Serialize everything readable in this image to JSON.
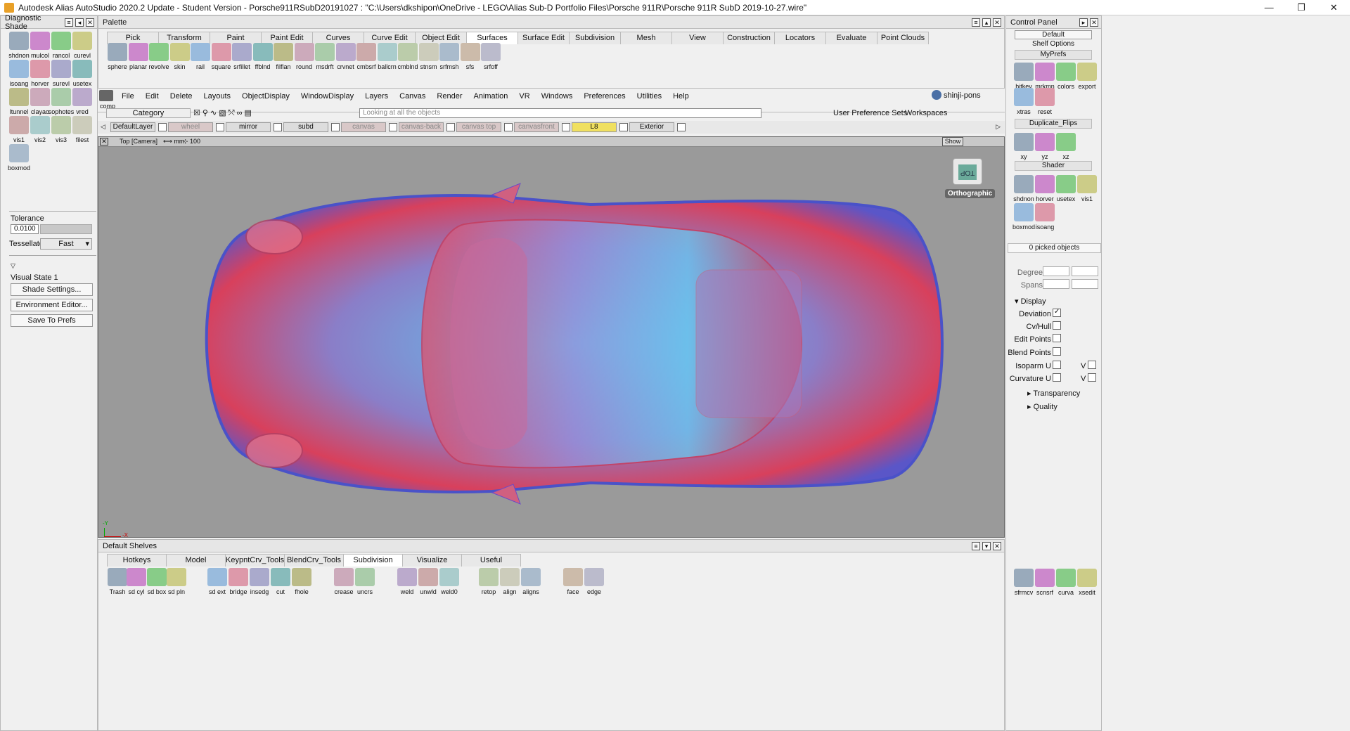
{
  "window": {
    "title": "Autodesk Alias AutoStudio 2020.2 Update - Student Version  - Porsche911RSubD20191027 : \"C:\\Users\\dkshipon\\OneDrive - LEGO\\Alias Sub-D Portfolio Files\\Porsche 911R\\Porsche 911R SubD 2019-10-27.wire\"",
    "minimize": "—",
    "restore": "❐",
    "close": "✕"
  },
  "left_panel": {
    "title": "Diagnostic Shade",
    "tools": [
      "shdnon",
      "mulcol",
      "rancol",
      "curevl",
      "isoang",
      "horver",
      "surevl",
      "usetex",
      "ltunnel",
      "clayao",
      "sophotes",
      "vred",
      "vis1",
      "vis2",
      "vis3",
      "filest",
      "boxmod"
    ],
    "tolerance_label": "Tolerance",
    "tolerance_value": "0.0100",
    "tessellator_label": "Tessellator",
    "tessellator_value": "Fast",
    "visual_state": "Visual State 1",
    "shade_settings": "Shade Settings...",
    "environment_editor": "Environment Editor...",
    "save_prefs": "Save To Prefs"
  },
  "palette": {
    "title": "Palette",
    "tabs": [
      "Pick",
      "Transform",
      "Paint",
      "Paint Edit",
      "Curves",
      "Curve Edit",
      "Object Edit",
      "Surfaces",
      "Surface Edit",
      "Subdivision",
      "Mesh",
      "View",
      "Construction",
      "Locators",
      "Evaluate",
      "Point Clouds"
    ],
    "active_tab": "Surfaces",
    "tools": [
      "sphere",
      "planar",
      "revolve",
      "skin",
      "rail",
      "square",
      "srfillet",
      "ffblnd",
      "filflan",
      "round",
      "msdrft",
      "crvnet",
      "cmbsrf",
      "ballcrn",
      "cmblnd",
      "stnsm",
      "srfmsh",
      "sfs",
      "srfoff"
    ]
  },
  "menubar": {
    "comp": "comp",
    "items": [
      "File",
      "Edit",
      "Delete",
      "Layouts",
      "ObjectDisplay",
      "WindowDisplay",
      "Layers",
      "Canvas",
      "Render",
      "Animation",
      "VR",
      "Windows",
      "Preferences",
      "Utilities",
      "Help"
    ],
    "user": "shinji-pons"
  },
  "category_bar": {
    "category": "Category",
    "search_placeholder": "Looking at all the objects",
    "user_pref_sets": "User Preference Sets",
    "workspaces": "Workspaces"
  },
  "layers": [
    "DefaultLayer",
    "wheel",
    "mirror",
    "subd",
    "canvas",
    "canvas-back",
    "canvas top",
    "canvasfront",
    "L8",
    "Exterior"
  ],
  "viewport": {
    "label": "Top [Camera]",
    "units": "mm",
    "zoom": "100",
    "view_cube": "TOP",
    "projection": "Orthographic",
    "show": "Show",
    "axis_x": "-X",
    "axis_y": "-Y"
  },
  "control_panel": {
    "title": "Control Panel",
    "preset": "Default",
    "shelf_options": "Shelf Options",
    "myprefs": "MyPrefs",
    "myprefs_tools": [
      "hitkey",
      "mrkmn",
      "colors",
      "export",
      "xtras",
      "reset"
    ],
    "dup_flips": "Duplicate_Flips",
    "dup_tools": [
      "xy",
      "yz",
      "xz"
    ],
    "shader": "Shader",
    "shader_tools": [
      "shdnon",
      "horver",
      "usetex",
      "vis1",
      "boxmod",
      "isoang"
    ],
    "picked": "0 picked objects",
    "degree": "Degree",
    "spans": "Spans",
    "display": "Display",
    "deviation": "Deviation",
    "cvhull": "Cv/Hull",
    "edit_points": "Edit Points",
    "blend_points": "Blend Points",
    "isoparm_u": "Isoparm U",
    "curvature_u": "Curvature U",
    "v": "V",
    "transparency": "Transparency",
    "quality": "Quality",
    "bottom_tools": [
      "sfrmcv",
      "scnsrf",
      "curva",
      "xsedit"
    ]
  },
  "shelves": {
    "title": "Default Shelves",
    "tabs": [
      "Hotkeys",
      "Model",
      "KeypntCrv_Tools",
      "BlendCrv_Tools",
      "Subdivision",
      "Visualize",
      "Useful"
    ],
    "active_tab": "Subdivision",
    "tools": [
      "Trash",
      "sd cyl",
      "sd box",
      "sd pln",
      "sd ext",
      "bridge",
      "insedg",
      "cut",
      "fhole",
      "crease",
      "uncrs",
      "weld",
      "unwld",
      "weld0",
      "retop",
      "align",
      "aligns",
      "face",
      "edge"
    ]
  }
}
